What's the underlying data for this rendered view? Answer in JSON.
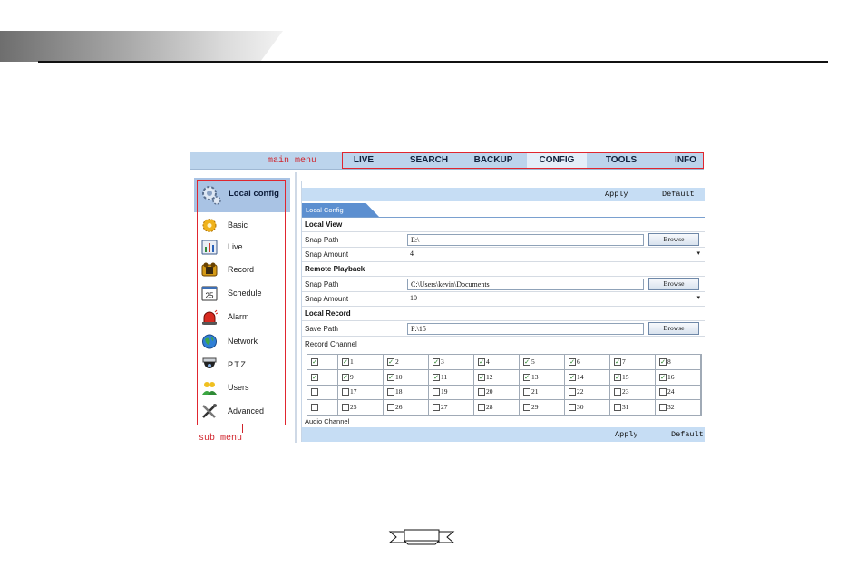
{
  "annotations": {
    "main_menu": "main menu",
    "sub_menu": "sub menu"
  },
  "top_menu": {
    "items": [
      "LIVE",
      "SEARCH",
      "BACKUP",
      "CONFIG",
      "TOOLS",
      "INFO"
    ],
    "active": "CONFIG"
  },
  "sidebar": {
    "header": "Local config",
    "items": [
      {
        "label": "Basic",
        "icon": "gear-sun-icon"
      },
      {
        "label": "Live",
        "icon": "chart-icon"
      },
      {
        "label": "Record",
        "icon": "film-reel-icon"
      },
      {
        "label": "Schedule",
        "icon": "calendar-icon"
      },
      {
        "label": "Alarm",
        "icon": "alarm-siren-icon"
      },
      {
        "label": "Network",
        "icon": "globe-icon"
      },
      {
        "label": "P.T.Z",
        "icon": "dome-camera-icon"
      },
      {
        "label": "Users",
        "icon": "users-icon"
      },
      {
        "label": "Advanced",
        "icon": "tools-icon"
      }
    ],
    "calendar_number": "25"
  },
  "panel": {
    "apply": "Apply",
    "default": "Default",
    "tab": "Local Config",
    "local_view": {
      "title": "Local View",
      "snap_path_label": "Snap Path",
      "snap_path_value": "E:\\",
      "snap_amount_label": "Snap Amount",
      "snap_amount_value": "4",
      "browse": "Browse"
    },
    "remote_playback": {
      "title": "Remote Playback",
      "snap_path_label": "Snap Path",
      "snap_path_value": "C:\\Users\\kevin\\Documents",
      "snap_amount_label": "Snap Amount",
      "snap_amount_value": "10",
      "browse": "Browse"
    },
    "local_record": {
      "title": "Local Record",
      "save_path_label": "Save Path",
      "save_path_value": "F:\\15",
      "browse": "Browse"
    },
    "record_channel_label": "Record Channel",
    "audio_channel_label": "Audio Channel",
    "channels": [
      {
        "label": "",
        "checked": true
      },
      {
        "label": "1",
        "checked": true
      },
      {
        "label": "2",
        "checked": true
      },
      {
        "label": "3",
        "checked": true
      },
      {
        "label": "4",
        "checked": true
      },
      {
        "label": "5",
        "checked": true
      },
      {
        "label": "6",
        "checked": true
      },
      {
        "label": "7",
        "checked": true
      },
      {
        "label": "8",
        "checked": true
      },
      {
        "label": "",
        "checked": true
      },
      {
        "label": "9",
        "checked": true
      },
      {
        "label": "10",
        "checked": true
      },
      {
        "label": "11",
        "checked": true
      },
      {
        "label": "12",
        "checked": true
      },
      {
        "label": "13",
        "checked": true
      },
      {
        "label": "14",
        "checked": true
      },
      {
        "label": "15",
        "checked": true
      },
      {
        "label": "16",
        "checked": true
      },
      {
        "label": "",
        "checked": false
      },
      {
        "label": "17",
        "checked": false
      },
      {
        "label": "18",
        "checked": false
      },
      {
        "label": "19",
        "checked": false
      },
      {
        "label": "20",
        "checked": false
      },
      {
        "label": "21",
        "checked": false
      },
      {
        "label": "22",
        "checked": false
      },
      {
        "label": "23",
        "checked": false
      },
      {
        "label": "24",
        "checked": false
      },
      {
        "label": "",
        "checked": false
      },
      {
        "label": "25",
        "checked": false
      },
      {
        "label": "26",
        "checked": false
      },
      {
        "label": "27",
        "checked": false
      },
      {
        "label": "28",
        "checked": false
      },
      {
        "label": "29",
        "checked": false
      },
      {
        "label": "30",
        "checked": false
      },
      {
        "label": "31",
        "checked": false
      },
      {
        "label": "32",
        "checked": false
      }
    ]
  },
  "colors": {
    "accent_red": "#e0262f",
    "menu_blue": "#bcd4ec",
    "tab_blue": "#5c8fd0"
  }
}
